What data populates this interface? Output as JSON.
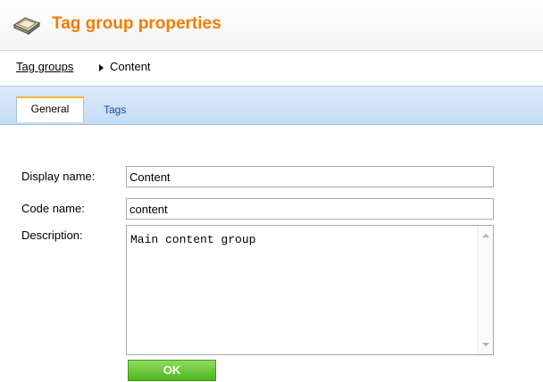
{
  "header": {
    "title": "Tag group properties",
    "icon": "tag-icon",
    "title_color": "#f07d00"
  },
  "breadcrumb": {
    "parent_label": "Tag groups",
    "current_label": "Content"
  },
  "tabs": [
    {
      "label": "General",
      "active": true
    },
    {
      "label": "Tags",
      "active": false
    }
  ],
  "form": {
    "display_name_label": "Display name:",
    "display_name_value": "Content",
    "code_name_label": "Code name:",
    "code_name_value": "content",
    "description_label": "Description:",
    "description_value": "Main content group",
    "ok_label": "OK"
  },
  "colors": {
    "accent_orange": "#f07d00",
    "tab_bar_blue": "#c6dcf6",
    "ok_green": "#4fb51f"
  }
}
